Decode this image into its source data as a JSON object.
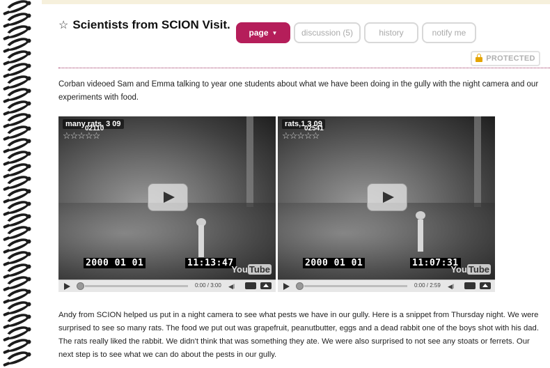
{
  "page": {
    "title": "Scientists from SCION Visit.",
    "protected_label": "PROTECTED"
  },
  "tabs": [
    {
      "label": "page",
      "active": true
    },
    {
      "label": "discussion (5)",
      "active": false
    },
    {
      "label": "history",
      "active": false
    },
    {
      "label": "notify me",
      "active": false
    }
  ],
  "intro": "Corban videoed Sam and Emma talking to year one students about what we have been doing in the gully with the night camera and our experiments with food.",
  "videos": [
    {
      "title": "many rats, 3 09",
      "code": "02110",
      "rating": "☆☆☆☆☆",
      "date_stamp": "2000 01 01",
      "time_stamp": "11:13:47",
      "duration": "0:00 / 3:00",
      "logo_you": "You",
      "logo_tube": "Tube"
    },
    {
      "title": "rats,1 3 09",
      "code": "02541",
      "rating": "☆☆☆☆☆",
      "date_stamp": "2000 01 01",
      "time_stamp": "11:07:31",
      "duration": "0:00 / 2:59",
      "logo_you": "You",
      "logo_tube": "Tube"
    }
  ],
  "body": "Andy from SCION helped us put in a night camera to see what pests we have in our gully. Here is a snippet from Thursday night. We were surprised to see so many rats. The food we put out was grapefruit, peanutbutter, eggs and a dead rabbit one of the boys shot with his dad. The rats really liked the rabbit. We didn't think that was something they ate. We were also surprised to not see any stoats or ferrets. Our next step is to see what we can do about the pests in our gully.",
  "colors": {
    "accent": "#b51e5a",
    "divider": "#9b2a5a",
    "lock": "#e4a400"
  }
}
